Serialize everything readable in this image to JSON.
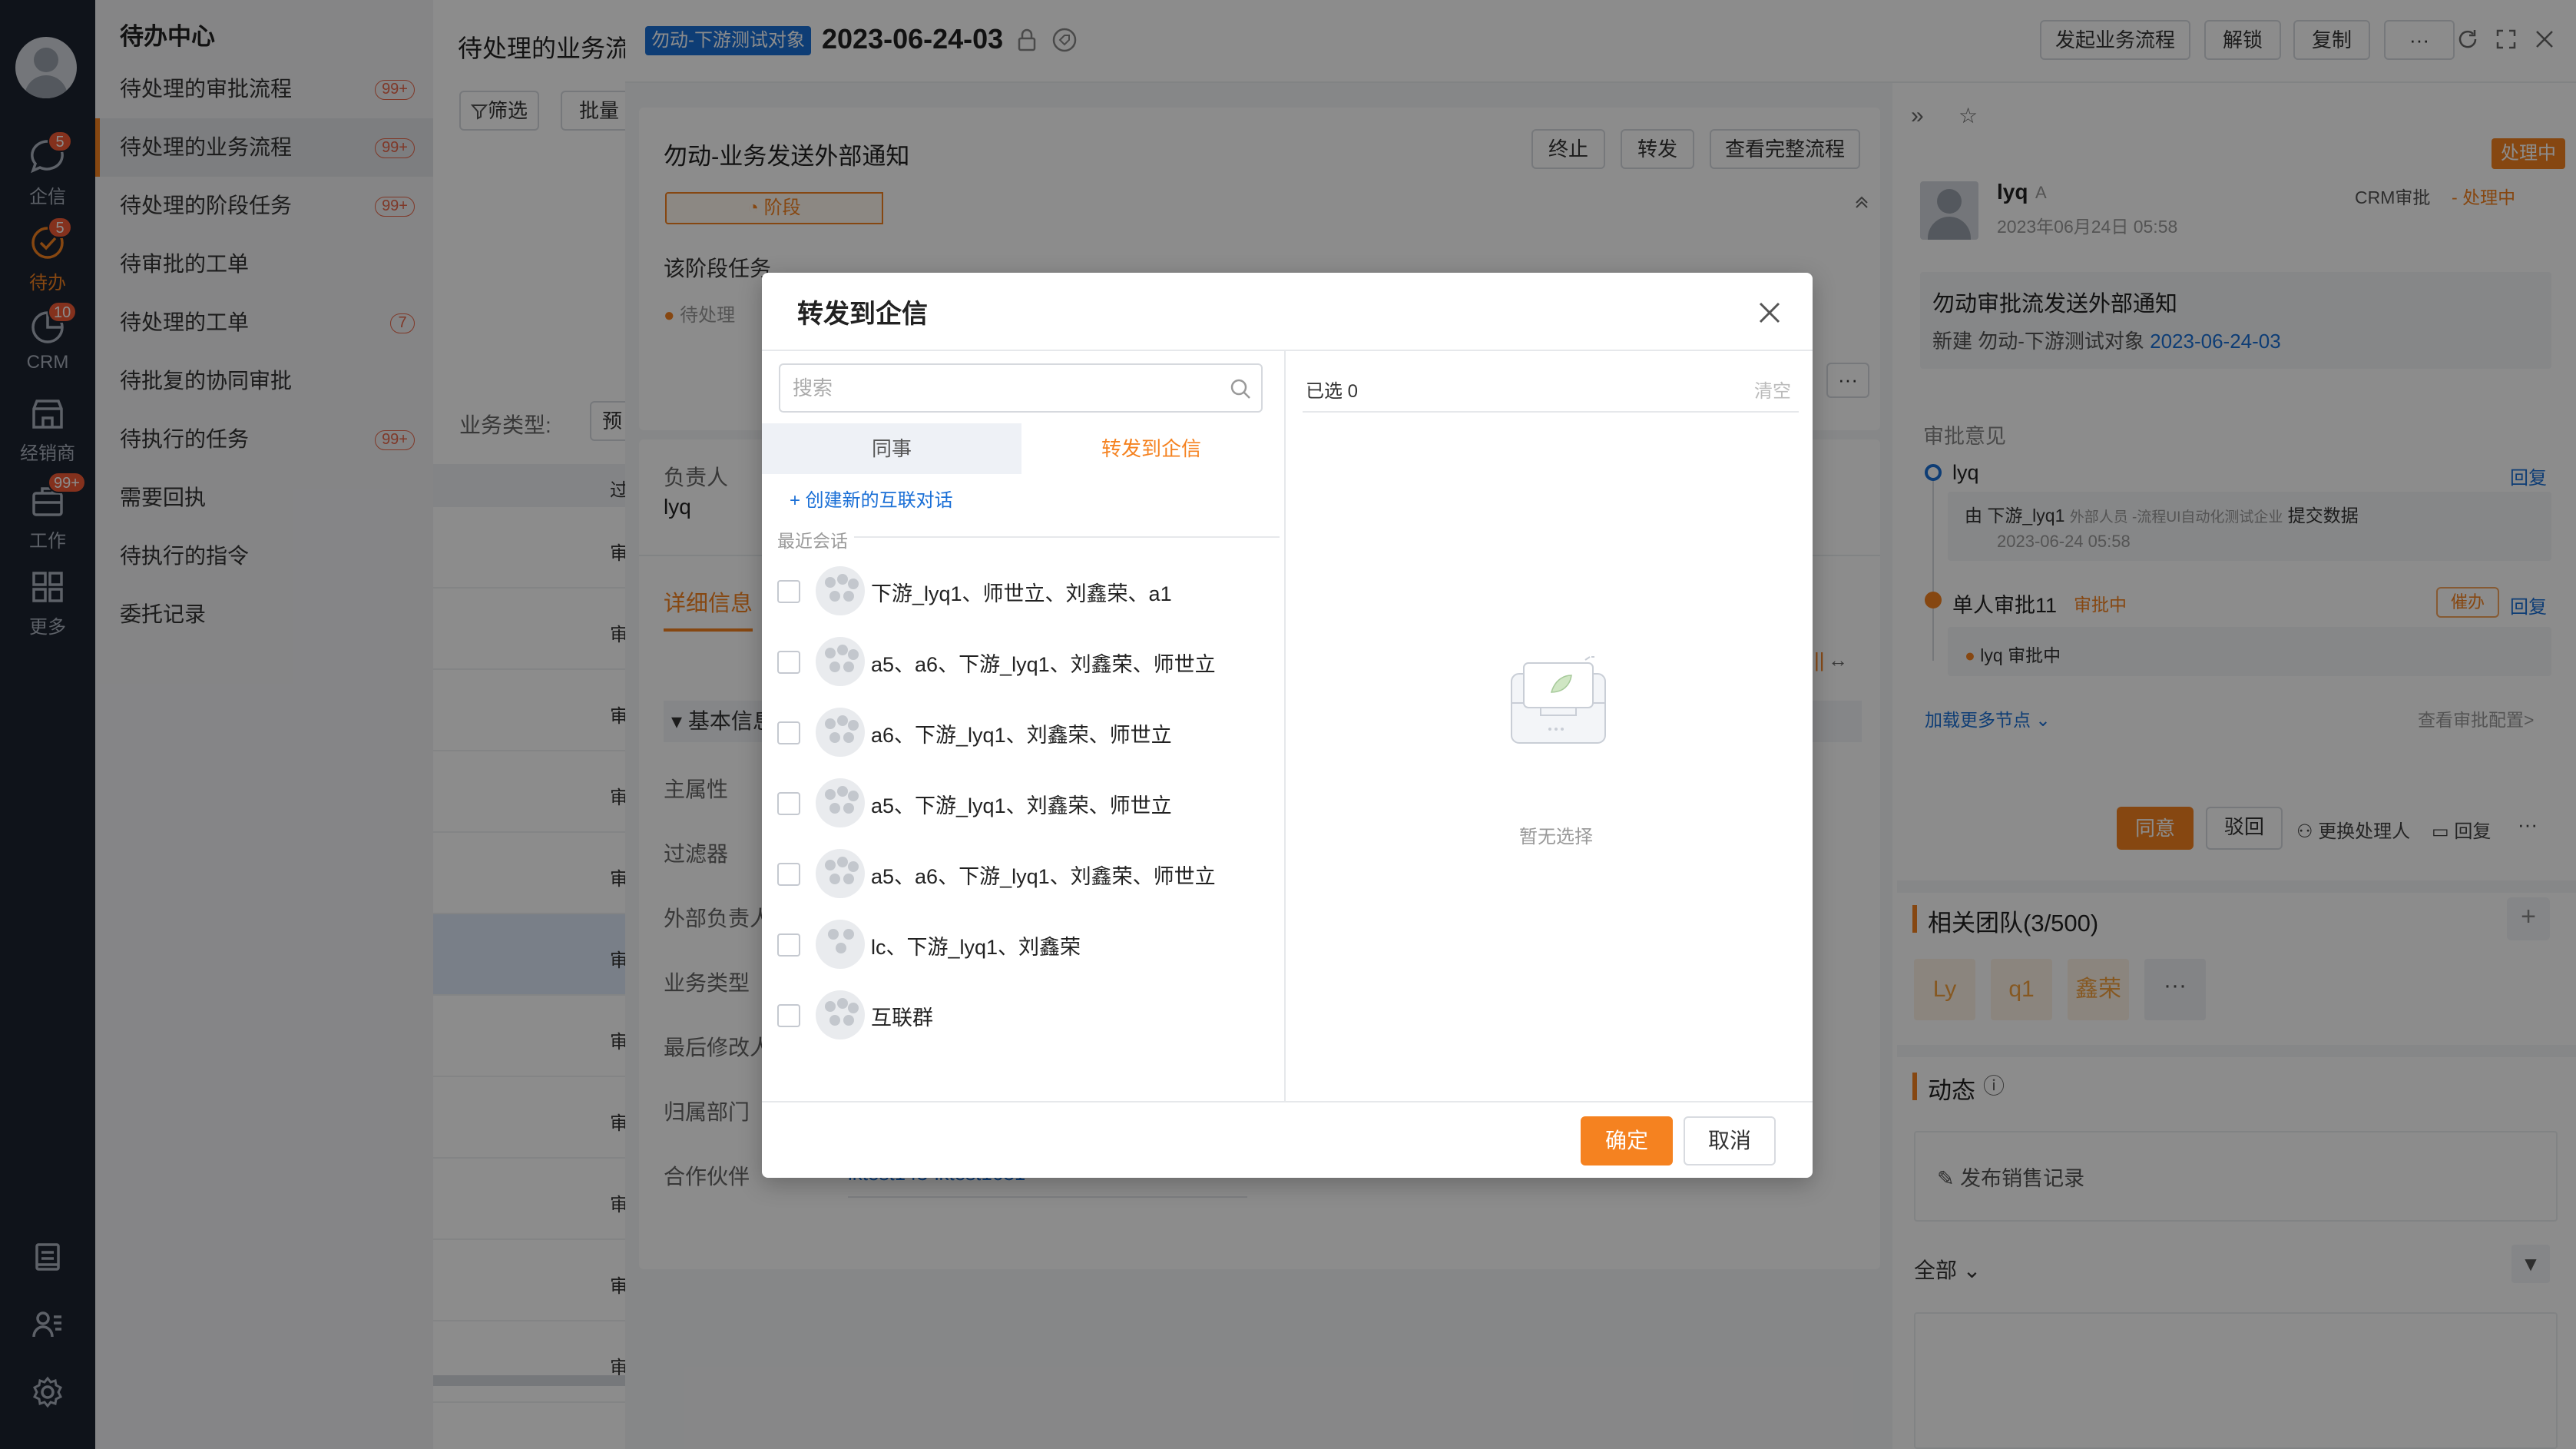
{
  "rail": {
    "items": [
      {
        "label": "企信",
        "badge": "5",
        "icon": "chat-icon"
      },
      {
        "label": "待办",
        "badge": "5",
        "icon": "todo-check-icon"
      },
      {
        "label": "CRM",
        "badge": "10",
        "icon": "crm-pie-icon"
      },
      {
        "label": "经销商",
        "badge": "",
        "icon": "store-icon"
      },
      {
        "label": "工作",
        "badge": "99+",
        "icon": "briefcase-icon"
      },
      {
        "label": "更多",
        "badge": "",
        "icon": "grid-icon"
      }
    ]
  },
  "nav": {
    "title": "待办中心",
    "items": [
      {
        "label": "待处理的审批流程",
        "badge": "99+"
      },
      {
        "label": "待处理的业务流程",
        "badge": "99+"
      },
      {
        "label": "待处理的阶段任务",
        "badge": "99+"
      },
      {
        "label": "待审批的工单",
        "badge": ""
      },
      {
        "label": "待处理的工单",
        "badge": "7"
      },
      {
        "label": "待批复的协同审批",
        "badge": ""
      },
      {
        "label": "待执行的任务",
        "badge": "99+"
      },
      {
        "label": "需要回执",
        "badge": ""
      },
      {
        "label": "待执行的指令",
        "badge": ""
      },
      {
        "label": "委托记录",
        "badge": ""
      }
    ]
  },
  "mid": {
    "title": "待处理的业务流",
    "filter_label": "筛选",
    "batch_label": "批量",
    "biz_type_label": "业务类型:",
    "biz_type_value": "预",
    "col_header": "过",
    "row_text": "审"
  },
  "header": {
    "tag": "勿动-下游测试对象",
    "title": "2023-06-24-03",
    "buttons": [
      "发起业务流程",
      "解锁",
      "复制",
      "···"
    ]
  },
  "flow": {
    "title": "勿动-业务发送外部通知",
    "buttons": [
      "终止",
      "转发",
      "查看完整流程"
    ],
    "stage_label": "阶段",
    "task_label": "该阶段任务",
    "pending_label": "待处理"
  },
  "info": {
    "owner_label": "负责人",
    "owner_value": "lyq",
    "detail_tab": "详细信息",
    "section": "基本信息",
    "fields": [
      "主属性",
      "过滤器",
      "外部负责人",
      "业务类型",
      "最后修改人",
      "归属部门",
      "合作伙伴"
    ],
    "partner_value": "lktest143-lktest1631"
  },
  "right": {
    "status_badge": "处理中",
    "user_name": "lyq",
    "user_suffix": "A",
    "user_time": "2023年06月24日 05:58",
    "crm_status": "CRM审批",
    "crm_state": "处理中",
    "notice_title": "勿动审批流发送外部通知",
    "notice_prefix": "新建 勿动-下游测试对象",
    "notice_link": "2023-06-24-03",
    "opinion_label": "审批意见",
    "n1_name": "lyq",
    "reply": "回复",
    "n1_sub_prefix": "由",
    "n1_sub_name": "下游_lyq1",
    "n1_sub_org": "外部人员 -流程UI自动化测试企业",
    "n1_sub_action": "提交数据",
    "n1_time": "2023-06-24 05:58",
    "n2_name": "单人审批11",
    "n2_state": "审批中",
    "urge": "催办",
    "n2_sub_name": "lyq",
    "n2_sub_state": "审批中",
    "load_more": "加载更多节点",
    "view_config": "查看审批配置>",
    "agree": "同意",
    "reject": "驳回",
    "change_handler": "更换处理人",
    "reply2": "回复",
    "more": "···",
    "team_title": "相关团队(3/500)",
    "team_members": [
      "Ly",
      "q1",
      "鑫荣"
    ],
    "dynamic_title": "动态",
    "publish_label": "发布销售记录",
    "all_label": "全部"
  },
  "modal": {
    "title": "转发到企信",
    "search_placeholder": "搜索",
    "tab_colleague": "同事",
    "tab_forward": "转发到企信",
    "create_link": "+ 创建新的互联对话",
    "recent_label": "最近会话",
    "conversations": [
      "下游_lyq1、师世立、刘鑫荣、a1",
      "a5、a6、下游_lyq1、刘鑫荣、师世立",
      "a6、下游_lyq1、刘鑫荣、师世立",
      "a5、下游_lyq1、刘鑫荣、师世立",
      "a5、a6、下游_lyq1、刘鑫荣、师世立",
      "lc、下游_lyq1、刘鑫荣",
      "互联群"
    ],
    "selected_label": "已选 0",
    "clear_label": "清空",
    "empty_label": "暂无选择",
    "confirm": "确定",
    "cancel": "取消"
  },
  "colors": {
    "accent": "#f58220",
    "link": "#1a6fd6",
    "rail_bg": "#1d2431",
    "badge": "#f05a35"
  }
}
